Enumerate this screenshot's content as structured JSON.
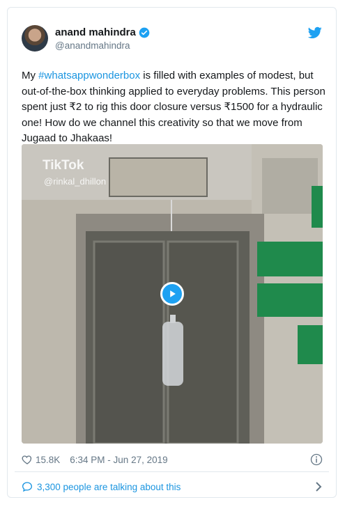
{
  "tweet": {
    "author": {
      "name": "anand mahindra",
      "handle": "@anandmahindra"
    },
    "text_parts": {
      "before_hashtag": "My ",
      "hashtag": "#whatsappwonderbox",
      "after_hashtag": " is filled with examples of modest, but out-of-the-box thinking applied to everyday problems. This person spent just ₹2 to rig this door closure versus ₹1500 for a hydraulic one! How do we channel this creativity so that we move from Jugaad to Jhakaas!"
    },
    "media": {
      "watermark_brand": "TikTok",
      "watermark_user": "@rinkal_dhillon"
    },
    "likes": "15.8K",
    "timestamp": "6:34 PM - Jun 27, 2019",
    "talking": "3,300 people are talking about this"
  },
  "colors": {
    "link": "#1b95e0",
    "twitter_blue": "#1da1f2",
    "text": "#14171a",
    "muted": "#657786",
    "border": "#e1e8ed"
  },
  "icons": [
    "verified-icon",
    "twitter-bird-icon",
    "play-icon",
    "heart-icon",
    "info-icon",
    "comment-icon",
    "chevron-right-icon"
  ]
}
